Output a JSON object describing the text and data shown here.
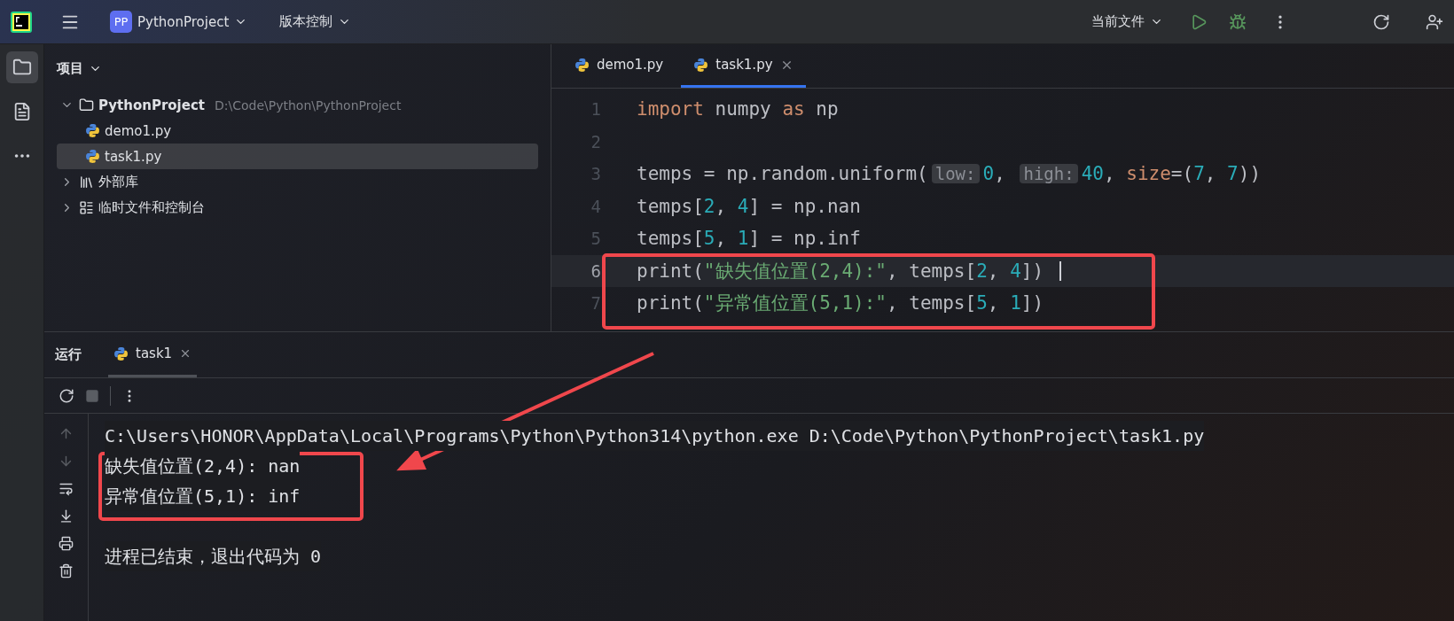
{
  "toolbar": {
    "project_badge": "PP",
    "project": "PythonProject",
    "vcs": "版本控制",
    "run_config": "当前文件"
  },
  "project_panel": {
    "title": "项目",
    "tree": [
      {
        "label": "PythonProject",
        "path": "D:\\Code\\Python\\PythonProject",
        "kind": "folder",
        "expanded": true,
        "selected": false,
        "children": [
          {
            "label": "demo1.py",
            "kind": "python",
            "selected": false
          },
          {
            "label": "task1.py",
            "kind": "python",
            "selected": true
          }
        ]
      },
      {
        "label": "外部库",
        "kind": "library",
        "expanded": false,
        "selected": false
      },
      {
        "label": "临时文件和控制台",
        "kind": "scratch",
        "expanded": false,
        "selected": false
      }
    ]
  },
  "editor": {
    "tabs": [
      {
        "label": "demo1.py",
        "selected": false,
        "closable": false
      },
      {
        "label": "task1.py",
        "selected": true,
        "closable": true
      }
    ],
    "lines": [
      {
        "number": "1",
        "current": false,
        "tokens": [
          {
            "kind": "kw",
            "text": "import"
          },
          {
            "kind": "plain",
            "text": " numpy "
          },
          {
            "kind": "kw",
            "text": "as"
          },
          {
            "kind": "plain",
            "text": " np"
          }
        ]
      },
      {
        "number": "2",
        "current": false
      },
      {
        "number": "3",
        "current": false,
        "tokens": [
          {
            "kind": "plain",
            "text": "temps = np.random.uniform("
          },
          {
            "kind": "hint",
            "text": "low:"
          },
          {
            "kind": "num",
            "text": "0"
          },
          {
            "kind": "plain",
            "text": ", "
          },
          {
            "kind": "hint",
            "text": "high:"
          },
          {
            "kind": "num",
            "text": "40"
          },
          {
            "kind": "plain",
            "text": ", "
          },
          {
            "kind": "param",
            "text": "size"
          },
          {
            "kind": "plain",
            "text": "=("
          },
          {
            "kind": "num",
            "text": "7"
          },
          {
            "kind": "plain",
            "text": ", "
          },
          {
            "kind": "num",
            "text": "7"
          },
          {
            "kind": "plain",
            "text": "))"
          }
        ]
      },
      {
        "number": "4",
        "current": false,
        "tokens": [
          {
            "kind": "plain",
            "text": "temps["
          },
          {
            "kind": "num",
            "text": "2"
          },
          {
            "kind": "plain",
            "text": ", "
          },
          {
            "kind": "num",
            "text": "4"
          },
          {
            "kind": "plain",
            "text": "] = np.nan"
          }
        ]
      },
      {
        "number": "5",
        "current": false,
        "tokens": [
          {
            "kind": "plain",
            "text": "temps["
          },
          {
            "kind": "num",
            "text": "5"
          },
          {
            "kind": "plain",
            "text": ", "
          },
          {
            "kind": "num",
            "text": "1"
          },
          {
            "kind": "plain",
            "text": "] = np.inf"
          }
        ]
      },
      {
        "number": "6",
        "current": true,
        "tokens": [
          {
            "kind": "plain",
            "text": "print("
          },
          {
            "kind": "str",
            "text": "\"缺失值位置(2,4):\""
          },
          {
            "kind": "plain",
            "text": ", temps["
          },
          {
            "kind": "num",
            "text": "2"
          },
          {
            "kind": "plain",
            "text": ", "
          },
          {
            "kind": "num",
            "text": "4"
          },
          {
            "kind": "plain",
            "text": "])"
          }
        ]
      },
      {
        "number": "7",
        "current": false,
        "tokens": [
          {
            "kind": "plain",
            "text": "print("
          },
          {
            "kind": "str",
            "text": "\"异常值位置(5,1):\""
          },
          {
            "kind": "plain",
            "text": ", temps["
          },
          {
            "kind": "num",
            "text": "5"
          },
          {
            "kind": "plain",
            "text": ", "
          },
          {
            "kind": "num",
            "text": "1"
          },
          {
            "kind": "plain",
            "text": "])"
          }
        ]
      }
    ]
  },
  "run_panel": {
    "title": "运行",
    "tabs": [
      {
        "label": "task1",
        "selected": true
      }
    ],
    "console": [
      {
        "kind": "command",
        "text": "C:\\Users\\HONOR\\AppData\\Local\\Programs\\Python\\Python314\\python.exe D:\\Code\\Python\\PythonProject\\task1.py"
      },
      {
        "kind": "output",
        "text": "缺失值位置(2,4): nan"
      },
      {
        "kind": "output",
        "text": "异常值位置(5,1): inf"
      },
      {
        "kind": "exit",
        "text": "进程已结束，退出代码为 0"
      }
    ]
  },
  "annotations": [
    {
      "kind": "box"
    },
    {
      "kind": "box"
    },
    {
      "kind": "arrow"
    }
  ]
}
